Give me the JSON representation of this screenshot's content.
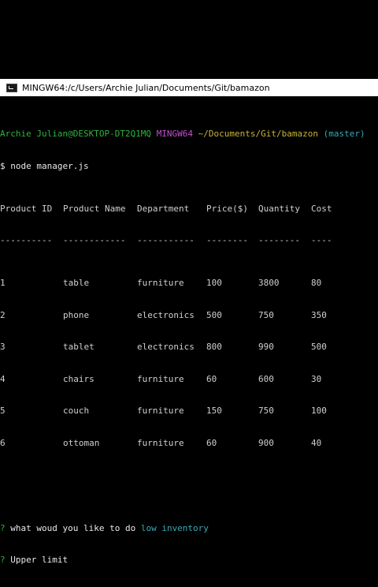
{
  "window": {
    "title": "MINGW64:/c/Users/Archie Julian/Documents/Git/bamazon",
    "icon": "terminal-icon"
  },
  "prompt": {
    "user_host": "Archie Julian@DESKTOP-DT2Q1MQ",
    "shell": "MINGW64",
    "path": "~/Documents/Git/bamazon",
    "branch": "(master)",
    "symbol": "$",
    "command": "node manager.js"
  },
  "table": {
    "headers": [
      "Product ID",
      "Product Name",
      "Department",
      "Price($)",
      "Quantity",
      "Cost"
    ],
    "separators": [
      "----------",
      "------------",
      "-----------",
      "--------",
      "--------",
      "----"
    ],
    "rows": [
      [
        "1",
        "table",
        "furniture",
        "100",
        "3800",
        "80"
      ],
      [
        "2",
        "phone",
        "electronics",
        "500",
        "750",
        "350"
      ],
      [
        "3",
        "tablet",
        "electronics",
        "800",
        "990",
        "500"
      ],
      [
        "4",
        "chairs",
        "furniture",
        "60",
        "600",
        "30"
      ],
      [
        "5",
        "couch",
        "furniture",
        "150",
        "750",
        "100"
      ],
      [
        "6",
        "ottoman",
        "furniture",
        "60",
        "900",
        "40"
      ]
    ]
  },
  "inquirer": {
    "q1_mark": "?",
    "q1_text": "what woud you like to do",
    "q1_answer": "low inventory",
    "q2_mark": "?",
    "q2_text": "Upper limit"
  },
  "colors": {
    "background": "#000000",
    "green": "#2fb340",
    "magenta": "#c34fd0",
    "yellow": "#c9b43a",
    "cyan": "#3aa9b5"
  }
}
